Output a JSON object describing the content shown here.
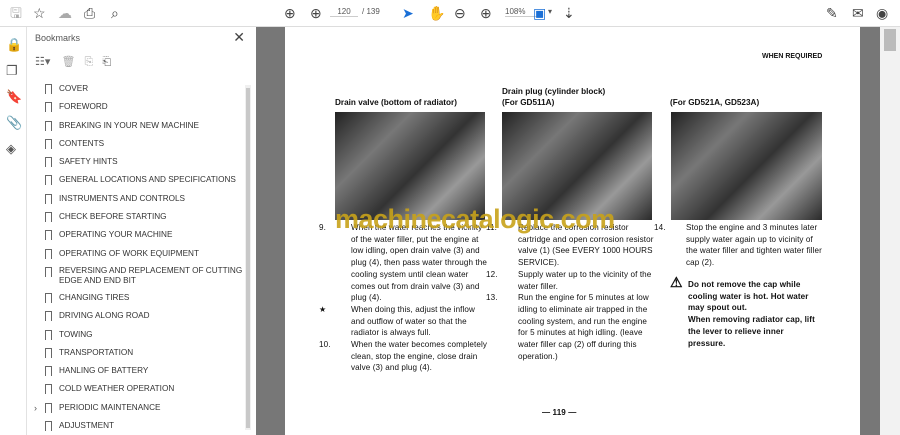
{
  "toolbar": {
    "page_current": "120",
    "page_total": "/ 139",
    "zoom": "108%"
  },
  "bookmarks": {
    "title": "Bookmarks",
    "items": [
      "COVER",
      "FOREWORD",
      "BREAKING IN YOUR NEW MACHINE",
      "CONTENTS",
      "SAFETY HINTS",
      "GENERAL LOCATIONS AND SPECIFICATIONS",
      "INSTRUMENTS AND CONTROLS",
      "CHECK BEFORE STARTING",
      "OPERATING YOUR MACHINE",
      "OPERATING OF WORK EQUIPMENT",
      "REVERSING AND REPLACEMENT OF CUTTING EDGE AND END BIT",
      "CHANGING TIRES",
      "DRIVING ALONG ROAD",
      "TOWING",
      "TRANSPORTATION",
      "HANLING OF BATTERY",
      "COLD WEATHER OPERATION",
      "PERIODIC MAINTENANCE",
      "ADJUSTMENT"
    ]
  },
  "doc": {
    "header": "WHEN REQUIRED",
    "col1_title": "Drain valve (bottom of radiator)",
    "col2_title": "Drain plug (cylinder block)\n(For GD511A)",
    "col3_title": "(For GD521A, GD523A)",
    "col1": [
      {
        "n": "9.",
        "t": "When the water reaches the vicinity of the water filler, put the engine at low idling, open drain valve (3) and plug (4), then pass water through the cooling system until clean water comes out from drain valve (3) and plug (4)."
      },
      {
        "n": "★",
        "t": "When doing this, adjust the inflow and outflow of water so that the radiator is always full."
      },
      {
        "n": "10.",
        "t": "When the water becomes completely clean, stop the engine, close drain valve (3) and plug (4)."
      }
    ],
    "col2": [
      {
        "n": "11.",
        "t": "Replace the corrosion resistor cartridge and open corrosion resistor valve (1) (See EVERY 1000 HOURS SERVICE)."
      },
      {
        "n": "12.",
        "t": "Supply water up to the vicinity of the water filler."
      },
      {
        "n": "13.",
        "t": "Run the engine for 5 minutes at low idling to eliminate air trapped in the cooling system, and run the engine for 5 minutes at high idling. (leave water filler cap (2) off during this operation.)"
      }
    ],
    "col3": [
      {
        "n": "14.",
        "t": "Stop the engine and 3 minutes later supply water again up to vicinity of the water filler and tighten water filler cap (2)."
      }
    ],
    "warning1": "Do not remove the cap while cooling water is hot. Hot water may spout out.",
    "warning2": "When removing radiator cap, lift the lever to relieve inner pressure.",
    "page_number": "— 119 —",
    "watermark": "machinecatalogic.com"
  }
}
